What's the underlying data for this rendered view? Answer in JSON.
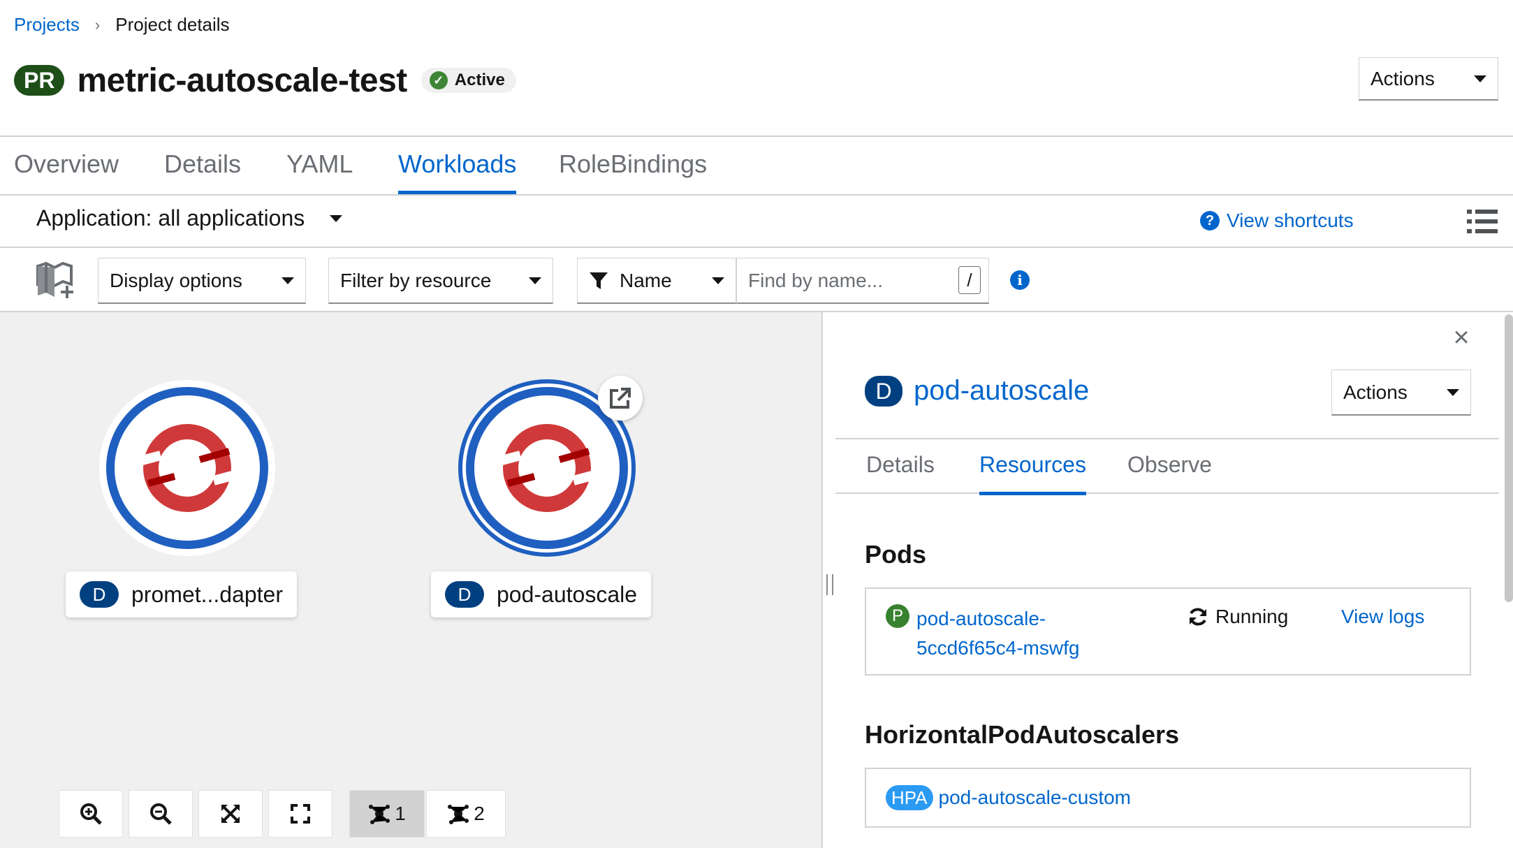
{
  "breadcrumb": {
    "parent": "Projects",
    "separator": "›",
    "current": "Project details"
  },
  "header": {
    "kind_badge": "PR",
    "title": "metric-autoscale-test",
    "status": "Active",
    "actions_label": "Actions"
  },
  "tabs": [
    "Overview",
    "Details",
    "YAML",
    "Workloads",
    "RoleBindings"
  ],
  "active_tab": "Workloads",
  "app_bar": {
    "application_selector": "Application: all applications",
    "view_shortcuts": "View shortcuts"
  },
  "toolbar": {
    "display_options": "Display options",
    "filter_by_resource": "Filter by resource",
    "name_filter": "Name",
    "search_placeholder": "Find by name...",
    "search_shortcut": "/",
    "info": "i"
  },
  "topology": {
    "nodes": [
      {
        "kind": "D",
        "label": "promet...dapter"
      },
      {
        "kind": "D",
        "label": "pod-autoscale"
      }
    ],
    "controls": {
      "layout1": "1",
      "layout2": "2"
    }
  },
  "side_panel": {
    "kind": "D",
    "title": "pod-autoscale",
    "actions_label": "Actions",
    "close": "×",
    "tabs": [
      "Details",
      "Resources",
      "Observe"
    ],
    "active_tab": "Resources",
    "pods": {
      "title": "Pods",
      "items": [
        {
          "badge": "P",
          "name_line1": "pod-autoscale-",
          "name_line2": "5ccd6f65c4-mswfg",
          "status": "Running",
          "logs_link": "View logs"
        }
      ]
    },
    "hpa": {
      "title": "HorizontalPodAutoscalers",
      "items": [
        {
          "badge": "HPA",
          "name": "pod-autoscale-custom"
        }
      ]
    }
  },
  "colors": {
    "link": "#0066cc",
    "node_ring": "#1f5fc0",
    "openshift_red": "#d0393a",
    "project_badge": "#1e4f18",
    "deployment_badge": "#004080"
  }
}
